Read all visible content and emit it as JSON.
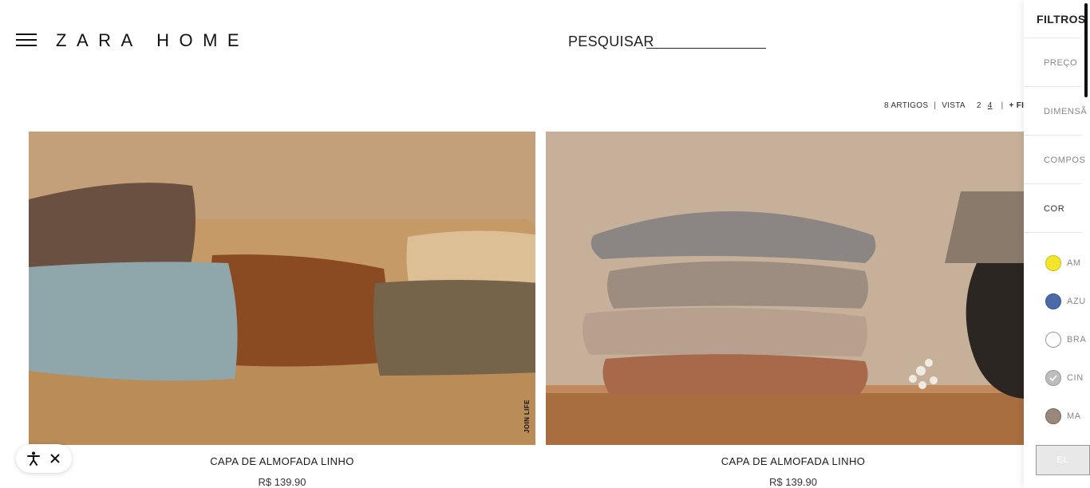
{
  "header": {
    "logo": "ZARA HOME",
    "search_label": "PESQUISAR"
  },
  "toolbar": {
    "count": "8 ARTIGOS",
    "separator": "|",
    "view_label": "VISTA",
    "view_options": [
      "2",
      "4"
    ],
    "active_view": "4",
    "filter_label": "+ FILT"
  },
  "products": [
    {
      "title": "CAPA DE ALMOFADA LINHO",
      "price": "R$ 139.90",
      "badge": "JOIN LIFE"
    },
    {
      "title": "CAPA DE ALMOFADA LINHO",
      "price": "R$ 139.90"
    }
  ],
  "filters": {
    "title": "FILTROS",
    "sections": [
      "PREÇO",
      "DIMENSÃ",
      "COMPOS",
      "COR"
    ],
    "active_section": "COR",
    "colors": [
      {
        "label": "AM",
        "hex": "#f2e52c"
      },
      {
        "label": "AZU",
        "hex": "#4b6aa8"
      },
      {
        "label": "BRA",
        "hex": "#ffffff"
      },
      {
        "label": "CIN",
        "hex": "#bdbdbd"
      },
      {
        "label": "MA",
        "hex": "#98877a"
      }
    ],
    "apply_label": "EL"
  },
  "accessibility": {
    "icons": [
      "accessibility-icon",
      "close-icon"
    ]
  }
}
